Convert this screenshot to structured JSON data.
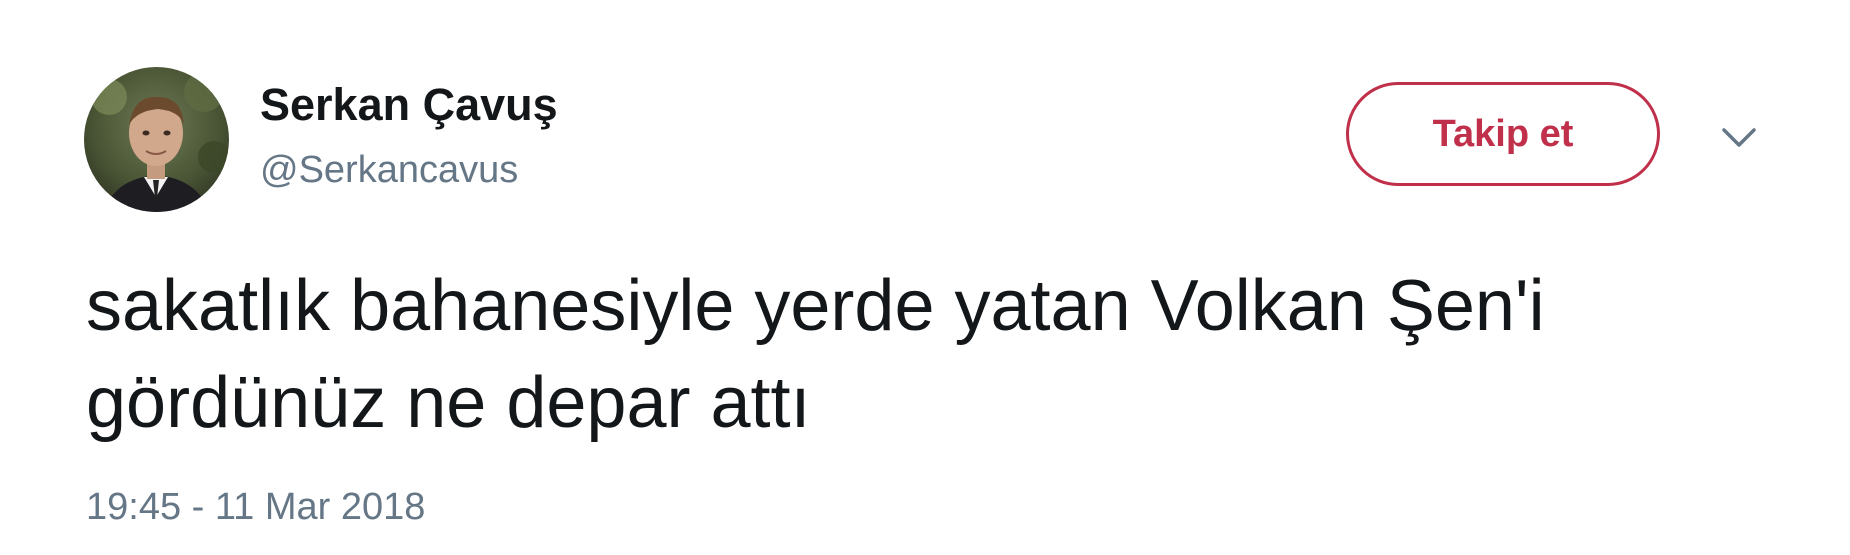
{
  "author": {
    "display_name": "Serkan Çavuş",
    "handle": "@Serkancavus",
    "avatar_icon": "user-photo-avatar"
  },
  "follow_button": {
    "label": "Takip et",
    "accent_color": "#c0304a"
  },
  "menu": {
    "icon": "chevron-down-icon"
  },
  "tweet": {
    "text_lines": [
      "sakatlık bahanesiyle yerde yatan Volkan Şen'i",
      "gördünüz ne depar attı"
    ],
    "timestamp": "19:45 - 11 Mar 2018"
  }
}
